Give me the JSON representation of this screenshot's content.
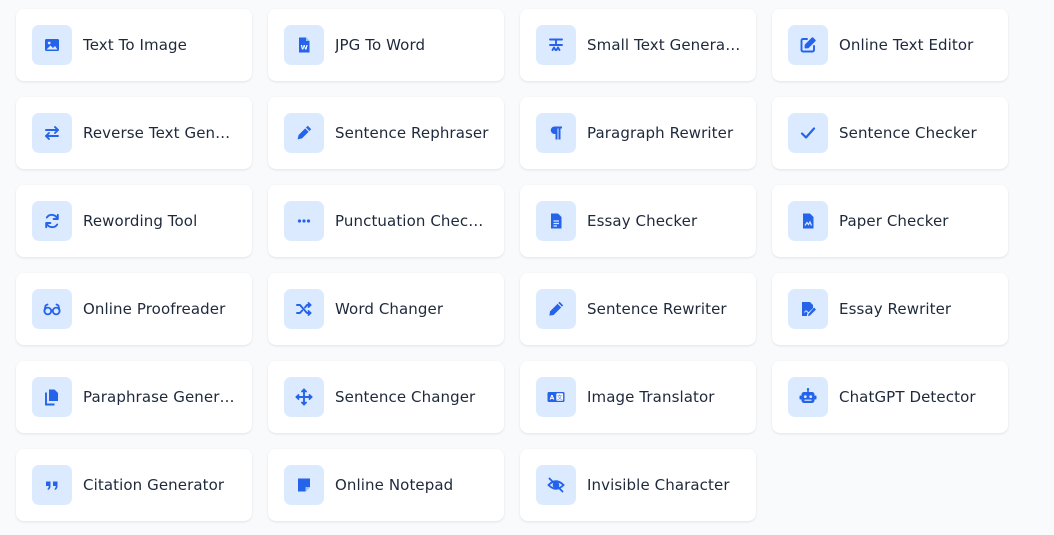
{
  "tools": [
    {
      "label": "Text To Image",
      "icon": "image-icon"
    },
    {
      "label": "JPG To Word",
      "icon": "word-file-icon"
    },
    {
      "label": "Small Text Generator",
      "icon": "text-resize-icon"
    },
    {
      "label": "Online Text Editor",
      "icon": "edit-icon"
    },
    {
      "label": "Reverse Text Generator",
      "icon": "swap-arrows-icon"
    },
    {
      "label": "Sentence Rephraser",
      "icon": "pen-icon"
    },
    {
      "label": "Paragraph Rewriter",
      "icon": "pilcrow-icon"
    },
    {
      "label": "Sentence Checker",
      "icon": "checkmark-icon"
    },
    {
      "label": "Rewording Tool",
      "icon": "refresh-icon"
    },
    {
      "label": "Punctuation Checker",
      "icon": "ellipsis-icon"
    },
    {
      "label": "Essay Checker",
      "icon": "document-icon"
    },
    {
      "label": "Paper Checker",
      "icon": "paper-icon"
    },
    {
      "label": "Online Proofreader",
      "icon": "glasses-icon"
    },
    {
      "label": "Word Changer",
      "icon": "shuffle-icon"
    },
    {
      "label": "Sentence Rewriter",
      "icon": "pencil-icon"
    },
    {
      "label": "Essay Rewriter",
      "icon": "signature-icon"
    },
    {
      "label": "Paraphrase Generator",
      "icon": "copy-icon"
    },
    {
      "label": "Sentence Changer",
      "icon": "move-arrows-icon"
    },
    {
      "label": "Image Translator",
      "icon": "language-icon"
    },
    {
      "label": "ChatGPT Detector",
      "icon": "robot-icon"
    },
    {
      "label": "Citation Generator",
      "icon": "quote-icon"
    },
    {
      "label": "Online Notepad",
      "icon": "note-icon"
    },
    {
      "label": "Invisible Character",
      "icon": "eye-slash-icon"
    }
  ],
  "colors": {
    "accent": "#2563eb",
    "icon_bg": "#dbeafe",
    "card_bg": "#ffffff",
    "page_bg": "#f8fafc",
    "text": "#1e293b"
  }
}
